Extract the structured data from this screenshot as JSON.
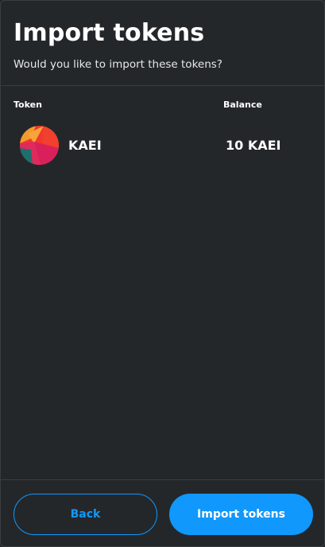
{
  "header": {
    "title": "Import tokens",
    "subtitle": "Would you like to import these tokens?"
  },
  "table": {
    "columns": {
      "token": "Token",
      "balance": "Balance"
    },
    "rows": [
      {
        "symbol": "KAEI",
        "balance": "10 KAEI",
        "icon": "token-identicon"
      }
    ]
  },
  "footer": {
    "back_label": "Back",
    "import_label": "Import tokens"
  },
  "colors": {
    "background": "#24272a",
    "accent": "#1098fc",
    "divider": "#3b3e41"
  }
}
